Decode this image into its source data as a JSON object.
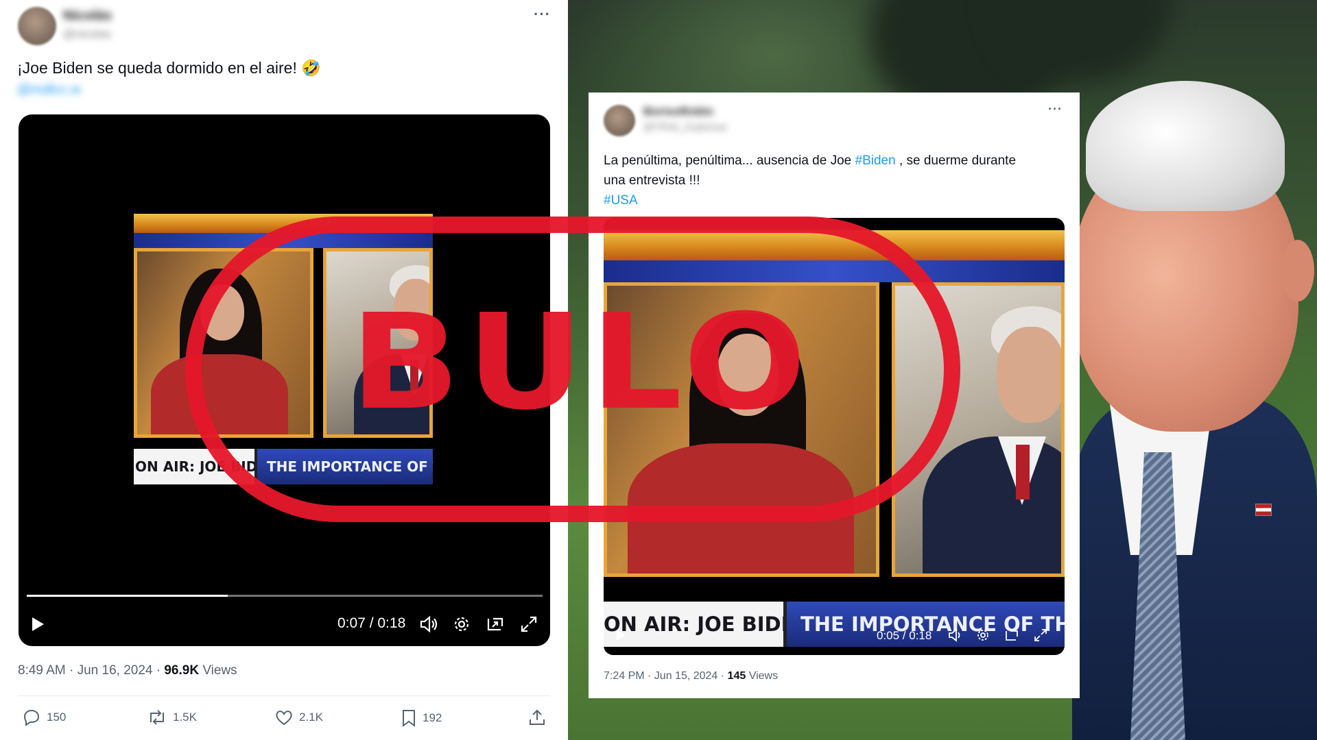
{
  "left_tweet": {
    "author_name": "Nicolás",
    "author_handle": "@nicolas",
    "text": "¡Joe Biden se queda dormido en el aire! 🤣",
    "link_text": "@mdlcc.w",
    "video": {
      "emojis": "😂😂😂",
      "ticker_left": "ON AIR: JOE BIDEN",
      "ticker_right": "THE IMPORTANCE OF THIS",
      "time": "0:07 / 0:18",
      "progress": 0.39
    },
    "timestamp": "8:49 AM · Jun 16, 2024 · ",
    "views_count": "96.9K",
    "views_label": " Views",
    "actions": {
      "replies": "150",
      "reposts": "1.5K",
      "likes": "2.1K",
      "bookmarks": "192"
    }
  },
  "right_tweet": {
    "author_name": "BorisoRoblo",
    "author_handle": "@TRsb_Zcplunua",
    "text_before": "La penúltima, penúltima... ausencia de Joe ",
    "hashtag_biden": "#Biden",
    "text_after": " , se duerme durante",
    "text_line2": "una entrevista !!!",
    "hashtag_usa": "#USA",
    "video": {
      "ticker_left": "ON AIR: JOE BIDEN",
      "ticker_right": "THE IMPORTANCE OF THIS",
      "time": "0:05 / 0:18"
    },
    "timestamp": "7:24 PM · Jun 15, 2024 · ",
    "views_count": "145",
    "views_label": " Views"
  },
  "stamp": {
    "text": "BULO",
    "color": "#e4182b"
  },
  "colors": {
    "link_blue": "#1d9bf0",
    "muted_gray": "#536471"
  }
}
